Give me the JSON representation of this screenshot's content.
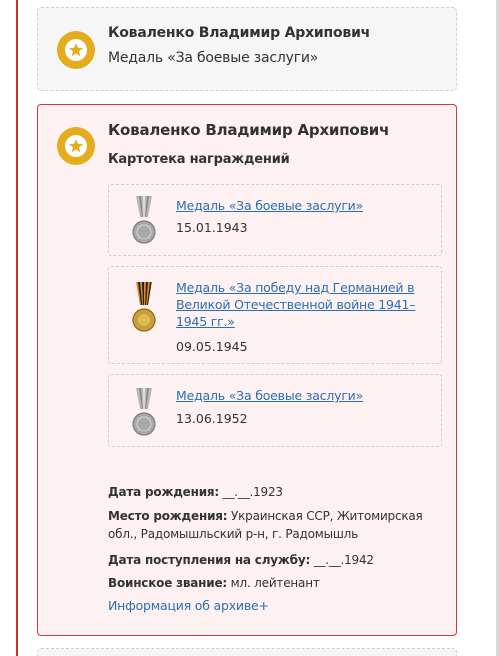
{
  "colors": {
    "accent": "#d23b3b",
    "link": "#2a6fb3",
    "emblem_gold": "#e4ad1d",
    "active_card_bg": "#fdf1f1",
    "plain_card_bg": "#f6f6f6"
  },
  "cards": [
    {
      "emblem_icon": "star-medal-icon",
      "name": "Коваленко Владимир Архипович",
      "subtitle": "Медаль «За боевые заслуги»"
    },
    {
      "emblem_icon": "star-medal-icon",
      "name": "Коваленко Владимир Архипович",
      "subtitle": "Картотека награждений",
      "awards": [
        {
          "icon": "combat-merit-medal-icon",
          "title": "Медаль «За боевые заслуги»",
          "date": "15.01.1943"
        },
        {
          "icon": "victory-over-germany-medal-icon",
          "title": "Медаль «За победу над Германией в Великой Отечественной войне 1941–1945 гг.»",
          "date": "09.05.1945"
        },
        {
          "icon": "combat-merit-medal-icon",
          "title": "Медаль «За боевые заслуги»",
          "date": "13.06.1952"
        }
      ],
      "info": {
        "birthdate_label": "Дата рождения:",
        "birthdate_value": " __.__.1923",
        "birthplace_label": "Место рождения:",
        "birthplace_value": " Украинская ССР, Житомирская обл., Радомышльский р-н, г. Радомышль",
        "service_label": "Дата поступления на службу:",
        "service_value": " __.__.1942",
        "rank_label": "Воинское звание:",
        "rank_value": " мл. лейтенант"
      },
      "archive_link": "Информация об архиве+"
    }
  ]
}
